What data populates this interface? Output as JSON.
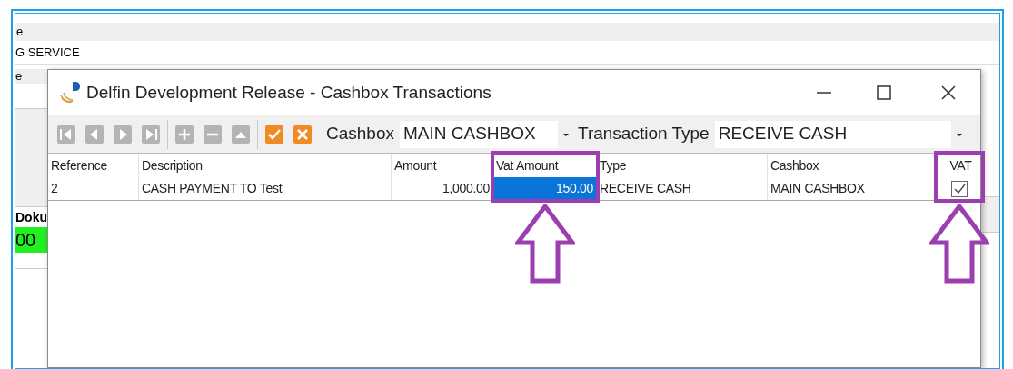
{
  "background": {
    "menu_fragment": "e",
    "service_fragment": "G SERVICE",
    "side_fragment": "e",
    "column_fragment": "Doku",
    "value_fragment": "00"
  },
  "dialog": {
    "title": "Delfin Development Release - Cashbox Transactions",
    "toolbar": [
      {
        "kind": "first",
        "disabled": true
      },
      {
        "kind": "prev",
        "disabled": true
      },
      {
        "kind": "next",
        "disabled": true
      },
      {
        "kind": "last",
        "disabled": true
      },
      {
        "kind": "add",
        "disabled": true
      },
      {
        "kind": "remove",
        "disabled": true
      },
      {
        "kind": "up",
        "disabled": true
      },
      {
        "kind": "confirm",
        "disabled": false
      },
      {
        "kind": "cancel",
        "disabled": false
      }
    ],
    "filters": [
      {
        "label": "Cashbox",
        "value": "MAIN CASHBOX"
      },
      {
        "label": "Transaction Type",
        "value": "RECEIVE CASH"
      }
    ],
    "table": {
      "columns": [
        "Reference",
        "Description",
        "Amount",
        "Vat Amount",
        "Type",
        "Cashbox",
        "VAT"
      ],
      "rows": [
        {
          "reference": "2",
          "description": "CASH PAYMENT TO Test",
          "amount": "1,000.00",
          "vat_amount": "150.00",
          "vat_amount_selected": true,
          "type": "RECEIVE CASH",
          "cashbox": "MAIN CASHBOX",
          "vat": true
        }
      ]
    }
  }
}
